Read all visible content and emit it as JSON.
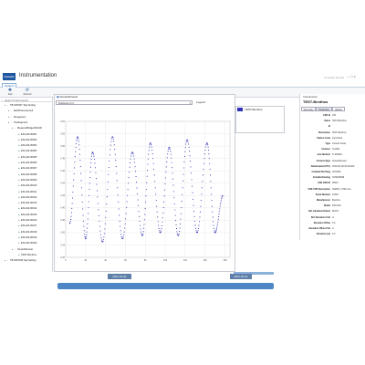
{
  "app": {
    "title": "Instrumentation",
    "logo_text": "Conetic",
    "right_link": "Concetto Fornite",
    "window_controls": "— ☐ ✕"
  },
  "menu": {
    "options_label": "Options"
  },
  "toolbar": {
    "buttons": [
      {
        "label": "Add",
        "icon": "plus-icon"
      },
      {
        "label": "Refresh",
        "icon": "refresh-icon"
      }
    ]
  },
  "tree": {
    "search_label": "Search Instruments",
    "rows": [
      {
        "label": "TB-SFP00T Tepl Setting",
        "icon": "folder-icon"
      },
      {
        "label": "EarthPressureCell",
        "icon": "folder-icon"
      },
      {
        "label": "Flexgeneric",
        "icon": "folder-icon"
      },
      {
        "label": "TestSegment",
        "icon": "folder-icon"
      },
      {
        "label": "MeasureBridge-B22AR",
        "icon": "folder-icon"
      },
      {
        "label": "EXL240-00001",
        "icon": "sensor-icon"
      },
      {
        "label": "EXL240-00002",
        "icon": "sensor-icon"
      },
      {
        "label": "EXL240-00003",
        "icon": "sensor-icon"
      },
      {
        "label": "EXL240-00004",
        "icon": "sensor-icon"
      },
      {
        "label": "EXL240-00005",
        "icon": "sensor-icon"
      },
      {
        "label": "EXL240-00006",
        "icon": "sensor-icon"
      },
      {
        "label": "EXL240-00007",
        "icon": "sensor-icon"
      },
      {
        "label": "EXL240-00008",
        "icon": "sensor-icon"
      },
      {
        "label": "EXL240-00009",
        "icon": "sensor-icon"
      },
      {
        "label": "EXL240-00010",
        "icon": "sensor-icon"
      },
      {
        "label": "EXL240-00011",
        "icon": "sensor-icon"
      },
      {
        "label": "EXL240-00012",
        "icon": "sensor-icon"
      },
      {
        "label": "EXL240-00013",
        "icon": "sensor-icon"
      },
      {
        "label": "EXL240-00014",
        "icon": "sensor-icon"
      },
      {
        "label": "EXL240-00015",
        "icon": "sensor-icon"
      },
      {
        "label": "EXL240-00016",
        "icon": "sensor-icon"
      },
      {
        "label": "EXL240-00017",
        "icon": "sensor-icon"
      },
      {
        "label": "EXL240-00018",
        "icon": "sensor-icon"
      },
      {
        "label": "EXL240-00019",
        "icon": "sensor-icon"
      },
      {
        "label": "EXL240-00020",
        "icon": "sensor-icon"
      },
      {
        "label": "SonarAltimeter",
        "icon": "folder-icon"
      },
      {
        "label": "TEST-Benthos",
        "icon": "sensor-icon"
      },
      {
        "label": "TB-SFP0G8 Tepl Setting",
        "icon": "folder-icon"
      }
    ]
  },
  "chart_panel": {
    "header": "SonarAltimeter",
    "series_combo": "Distance (m)",
    "legend_label": "Legend",
    "legend_entry": "TEST-Benthos"
  },
  "chart_data": {
    "type": "scatter",
    "x_ticks": [
      "0",
      "20",
      "40",
      "60",
      "80",
      "100",
      "120",
      "140",
      "160"
    ],
    "y_ticks": [
      "0.32",
      "0.34",
      "0.36",
      "0.38",
      "0.40",
      "0.42",
      "0.44",
      "0.46",
      "0.48",
      "0.50",
      "0.52",
      "0.54"
    ],
    "ylim": [
      0.32,
      0.54
    ],
    "xlim": [
      0,
      165
    ],
    "series": [
      {
        "name": "TEST-Benthos",
        "color": "#3131b8",
        "peaks": [
          {
            "x": 12,
            "y": 0.515
          },
          {
            "x": 27,
            "y": 0.49
          },
          {
            "x": 47,
            "y": 0.515
          },
          {
            "x": 67,
            "y": 0.49
          },
          {
            "x": 85,
            "y": 0.505
          },
          {
            "x": 104,
            "y": 0.498
          },
          {
            "x": 122,
            "y": 0.51
          },
          {
            "x": 142,
            "y": 0.505
          },
          {
            "x": 158,
            "y": 0.42
          }
        ],
        "troughs": [
          {
            "x": 4,
            "y": 0.375
          },
          {
            "x": 20,
            "y": 0.35
          },
          {
            "x": 37,
            "y": 0.345
          },
          {
            "x": 57,
            "y": 0.35
          },
          {
            "x": 77,
            "y": 0.355
          },
          {
            "x": 95,
            "y": 0.36
          },
          {
            "x": 113,
            "y": 0.355
          },
          {
            "x": 132,
            "y": 0.36
          },
          {
            "x": 150,
            "y": 0.36
          }
        ]
      }
    ]
  },
  "timeline": {
    "start_label": "2021-01-01",
    "end_label": "2021-03-31"
  },
  "right_panel": {
    "header": "Instruments",
    "name": "TEST-Benthos",
    "tabs": [
      "Summary",
      "Properties",
      "History"
    ],
    "properties": [
      {
        "key": "CDE Id",
        "value": "105"
      },
      {
        "key": "Name",
        "value": "TEST-Benthos"
      },
      {
        "key": "Id",
        "value": ""
      },
      {
        "key": "Description",
        "value": "TEST Benthos"
      },
      {
        "key": "Station Code",
        "value": "ImportTest"
      },
      {
        "key": "Type",
        "value": "Conetic Sonar"
      },
      {
        "key": "Instance",
        "value": "Test001"
      },
      {
        "key": "Join Number",
        "value": "TI-000001"
      },
      {
        "key": "InstanceType",
        "value": "SonarAltimeter"
      },
      {
        "key": "DateCreated (UTC)",
        "value": "2019-09-19T12:00:00Z"
      },
      {
        "key": "Installed Northing",
        "value": "4671656"
      },
      {
        "key": "Installed Easting",
        "value": "1159040898"
      },
      {
        "key": "CDE CRS ID",
        "value": "26910"
      },
      {
        "key": "CDE CRS Description",
        "value": "NAD83 / UTM zone"
      },
      {
        "key": "Serial Number",
        "value": "12345"
      },
      {
        "key": "Manufacturer",
        "value": "Benthos"
      },
      {
        "key": "Model",
        "value": "PSA-916"
      },
      {
        "key": "Ref. Elevation Datum",
        "value": "MLLW"
      },
      {
        "key": "Ref. Elevation Unit",
        "value": "m"
      },
      {
        "key": "Elevation Offset",
        "value": "0.0"
      },
      {
        "key": "Elevation Offset Unit",
        "value": "m"
      },
      {
        "key": "Elevation (m)",
        "value": "0.0"
      }
    ]
  }
}
